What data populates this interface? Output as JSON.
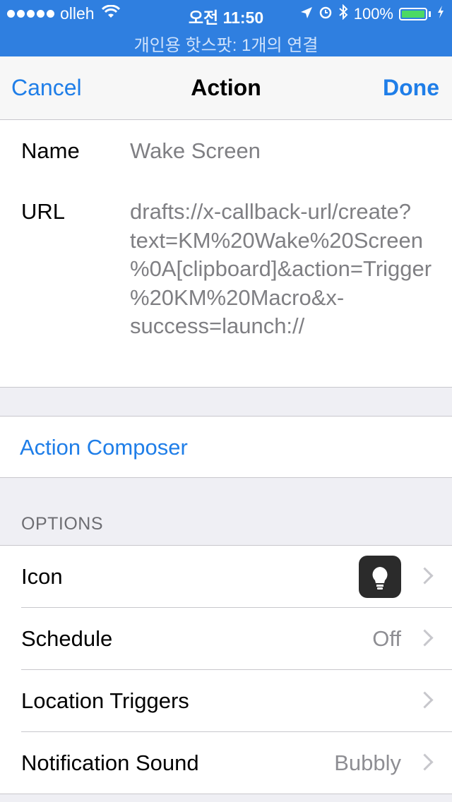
{
  "status_bar": {
    "carrier": "olleh",
    "time": "오전 11:50",
    "battery": "100%",
    "hotspot": "개인용 핫스팟: 1개의 연결",
    "icons": [
      "signal-dots-icon",
      "wifi-icon",
      "location-icon",
      "alarm-icon",
      "bluetooth-icon",
      "battery-icon"
    ]
  },
  "nav": {
    "cancel": "Cancel",
    "title": "Action",
    "done": "Done"
  },
  "fields": {
    "name_label": "Name",
    "name_value": "Wake Screen",
    "url_label": "URL",
    "url_value": "drafts://x-callback-url/create?text=KM%20Wake%20Screen%0A[clipboard]&action=Trigger%20KM%20Macro&x-success=launch://"
  },
  "composer": {
    "label": "Action Composer"
  },
  "options": {
    "header": "OPTIONS",
    "rows": [
      {
        "label": "Icon",
        "detail": ""
      },
      {
        "label": "Schedule",
        "detail": "Off"
      },
      {
        "label": "Location Triggers",
        "detail": ""
      },
      {
        "label": "Notification Sound",
        "detail": "Bubbly"
      }
    ]
  },
  "colors": {
    "accent": "#1f7ee8",
    "status_bar": "#2f7fe0",
    "background": "#efeff4"
  }
}
